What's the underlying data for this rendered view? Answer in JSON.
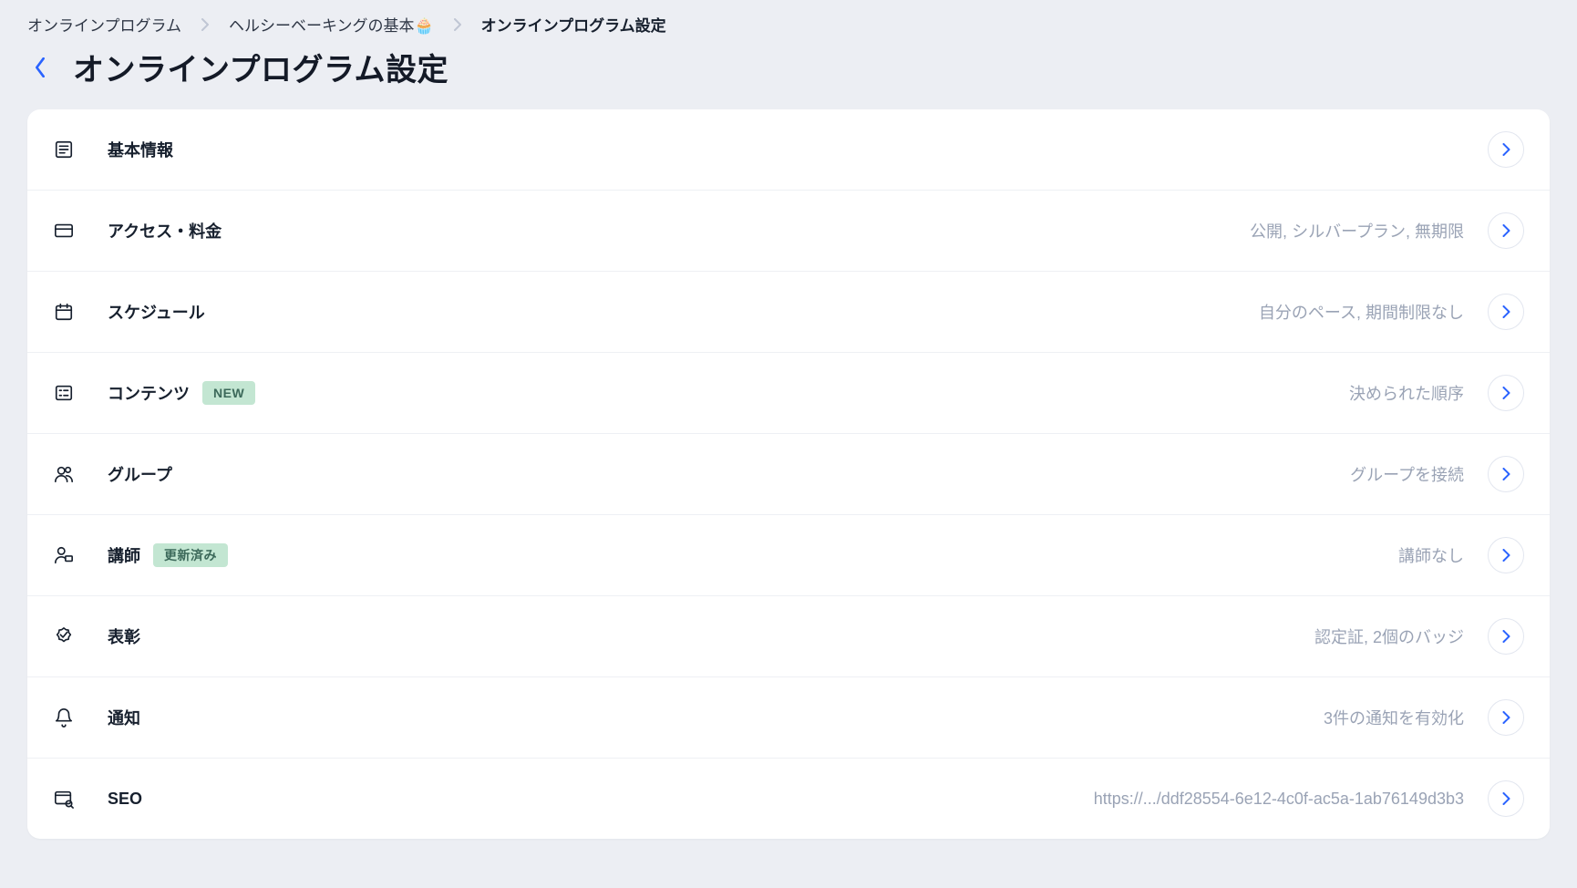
{
  "breadcrumbs": {
    "items": [
      {
        "label": "オンラインプログラム"
      },
      {
        "label": "ヘルシーベーキングの基本🧁"
      },
      {
        "label": "オンラインプログラム設定",
        "current": true
      }
    ]
  },
  "page_title": "オンラインプログラム設定",
  "badges": {
    "new": "NEW",
    "updated": "更新済み"
  },
  "rows": [
    {
      "id": "basic",
      "icon": "article-icon",
      "label": "基本情報",
      "summary": "",
      "badge": ""
    },
    {
      "id": "access",
      "icon": "card-icon",
      "label": "アクセス・料金",
      "summary": "公開, シルバープラン, 無期限",
      "badge": ""
    },
    {
      "id": "schedule",
      "icon": "calendar-icon",
      "label": "スケジュール",
      "summary": "自分のペース, 期間制限なし",
      "badge": ""
    },
    {
      "id": "contents",
      "icon": "list-icon",
      "label": "コンテンツ",
      "summary": "決められた順序",
      "badge": "new"
    },
    {
      "id": "groups",
      "icon": "users-icon",
      "label": "グループ",
      "summary": "グループを接続",
      "badge": ""
    },
    {
      "id": "lecturer",
      "icon": "person-icon",
      "label": "講師",
      "summary": "講師なし",
      "badge": "updated"
    },
    {
      "id": "awards",
      "icon": "badge-icon",
      "label": "表彰",
      "summary": "認定証, 2個のバッジ",
      "badge": ""
    },
    {
      "id": "notify",
      "icon": "bell-icon",
      "label": "通知",
      "summary": "3件の通知を有効化",
      "badge": ""
    },
    {
      "id": "seo",
      "icon": "seo-icon",
      "label": "SEO",
      "summary": "https://.../ddf28554-6e12-4c0f-ac5a-1ab76149d3b3",
      "badge": ""
    }
  ]
}
